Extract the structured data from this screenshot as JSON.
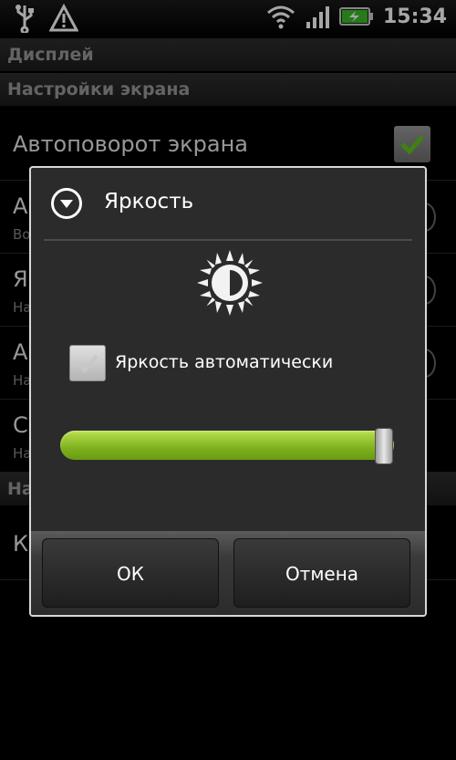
{
  "status_bar": {
    "time": "15:34",
    "icons": [
      "usb-icon",
      "warning-icon",
      "wifi-icon",
      "signal-icon",
      "battery-charging-icon"
    ]
  },
  "sections": {
    "display": "Дисплей",
    "screen_settings": "Настройки экрана"
  },
  "background_items": [
    {
      "title": "Автоповорот экрана"
    },
    {
      "title": "А",
      "subtitle": "Во"
    },
    {
      "title": "Я",
      "subtitle": "На"
    },
    {
      "title": "А",
      "subtitle": "На"
    },
    {
      "title": "С",
      "subtitle": "На"
    }
  ],
  "background_section_partial": "На",
  "background_last_item": "К",
  "dialog": {
    "title": "Яркость",
    "auto_brightness_label": "Яркость автоматически",
    "auto_brightness_checked": false,
    "brightness_level": 0.97,
    "ok_label": "ОК",
    "cancel_label": "Отмена"
  },
  "colors": {
    "slider_green": "#8cc21f",
    "background": "#000000",
    "dialog_bg": "#2b2b2b"
  }
}
